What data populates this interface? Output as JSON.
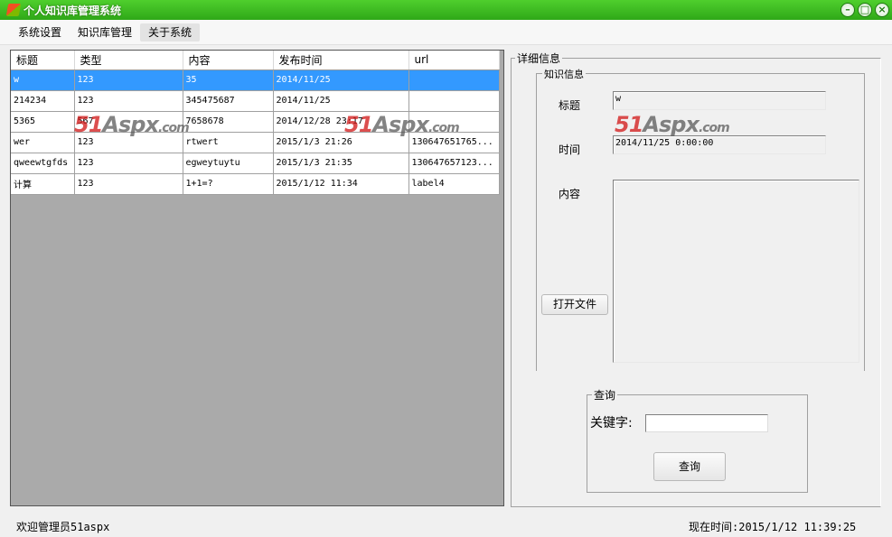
{
  "window": {
    "title": "个人知识库管理系统"
  },
  "menu": [
    "系统设置",
    "知识库管理",
    "关于系统"
  ],
  "grid": {
    "columns": [
      "标题",
      "类型",
      "内容",
      "发布时间",
      "url"
    ],
    "rows": [
      [
        "w",
        "123",
        "35",
        "2014/11/25",
        ""
      ],
      [
        "214234",
        "123",
        "345475687",
        "2014/11/25",
        ""
      ],
      [
        "5365",
        "567",
        "7658678",
        "2014/12/28 23:17",
        ""
      ],
      [
        "wer",
        "123",
        "rtwert",
        "2015/1/3 21:26",
        "130647651765..."
      ],
      [
        "qweewtgfds",
        "123",
        "egweytuytu",
        "2015/1/3 21:35",
        "130647657123..."
      ],
      [
        "计算",
        "123",
        "1+1=?",
        "2015/1/12 11:34",
        "label4"
      ]
    ],
    "selected_row": 0
  },
  "detail": {
    "group_title": "详细信息",
    "inner_group_title": "知识信息",
    "title_label": "标题",
    "title_value": "w",
    "time_label": "时间",
    "time_value": "2014/11/25 0:00:00",
    "content_label": "内容",
    "content_value": "",
    "open_file_button": "打开文件"
  },
  "search": {
    "group_title": "查询",
    "keyword_label": "关键字:",
    "keyword_value": "",
    "search_button": "查询"
  },
  "status": {
    "welcome": "欢迎管理员51aspx",
    "current_time": "现在时间:2015/1/12 11:39:25"
  },
  "watermark": {
    "brand": "51Aspx",
    "suffix": ".com"
  },
  "colors": {
    "titlebar": "#3bb81f",
    "selection": "#3399ff",
    "grid_background": "#aaaaaa"
  }
}
